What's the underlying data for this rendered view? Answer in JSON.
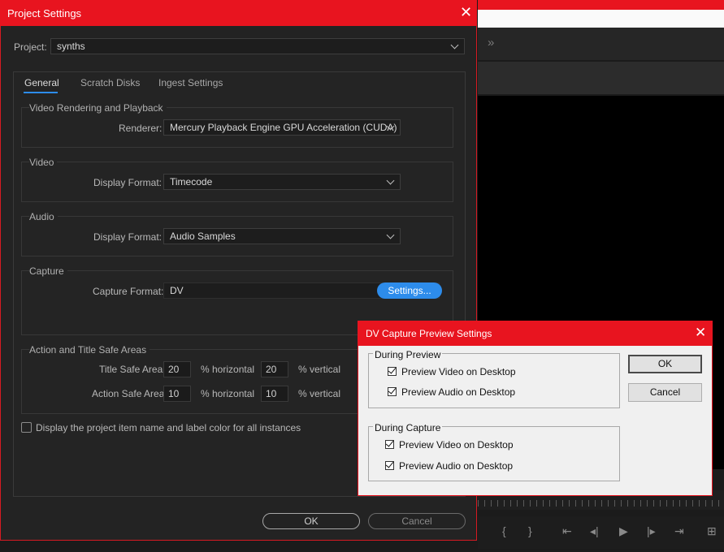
{
  "project_settings": {
    "title": "Project Settings",
    "project_label": "Project:",
    "project_value": "synths",
    "tabs": [
      {
        "label": "General",
        "active": true
      },
      {
        "label": "Scratch Disks",
        "active": false
      },
      {
        "label": "Ingest Settings",
        "active": false
      }
    ],
    "video_rendering": {
      "title": "Video Rendering and Playback",
      "renderer_label": "Renderer:",
      "renderer_value": "Mercury Playback Engine GPU Acceleration (CUDA)"
    },
    "video": {
      "title": "Video",
      "display_format_label": "Display Format:",
      "display_format_value": "Timecode"
    },
    "audio": {
      "title": "Audio",
      "display_format_label": "Display Format:",
      "display_format_value": "Audio Samples"
    },
    "capture": {
      "title": "Capture",
      "capture_format_label": "Capture Format:",
      "capture_format_value": "DV",
      "settings_button": "Settings..."
    },
    "safe_areas": {
      "title": "Action and Title Safe Areas",
      "title_safe_label": "Title Safe Area",
      "title_safe_h": "20",
      "title_safe_v": "20",
      "action_safe_label": "Action Safe Area",
      "action_safe_h": "10",
      "action_safe_v": "10",
      "horizontal_unit": "% horizontal",
      "vertical_unit": "% vertical"
    },
    "display_item_name_label": "Display the project item name and label color for all instances",
    "display_item_name_checked": false,
    "ok_button": "OK",
    "cancel_button": "Cancel"
  },
  "dv_capture": {
    "title": "DV Capture Preview Settings",
    "during_preview": {
      "legend": "During Preview",
      "items": [
        {
          "label": "Preview Video on Desktop",
          "checked": true
        },
        {
          "label": "Preview Audio on Desktop",
          "checked": true
        }
      ]
    },
    "during_capture": {
      "legend": "During Capture",
      "items": [
        {
          "label": "Preview Video on Desktop",
          "checked": true
        },
        {
          "label": "Preview Audio on Desktop",
          "checked": true
        }
      ]
    },
    "ok_button": "OK",
    "cancel_button": "Cancel"
  },
  "background": {
    "overflow_glyph": "»",
    "transport": [
      "{",
      "}",
      "⇤",
      "◂|",
      "▶",
      "|▸",
      "⇥",
      "⊞"
    ]
  },
  "colors": {
    "accent_red": "#e8141f",
    "accent_blue": "#2d8ceb",
    "dialog_bg": "#232323"
  }
}
